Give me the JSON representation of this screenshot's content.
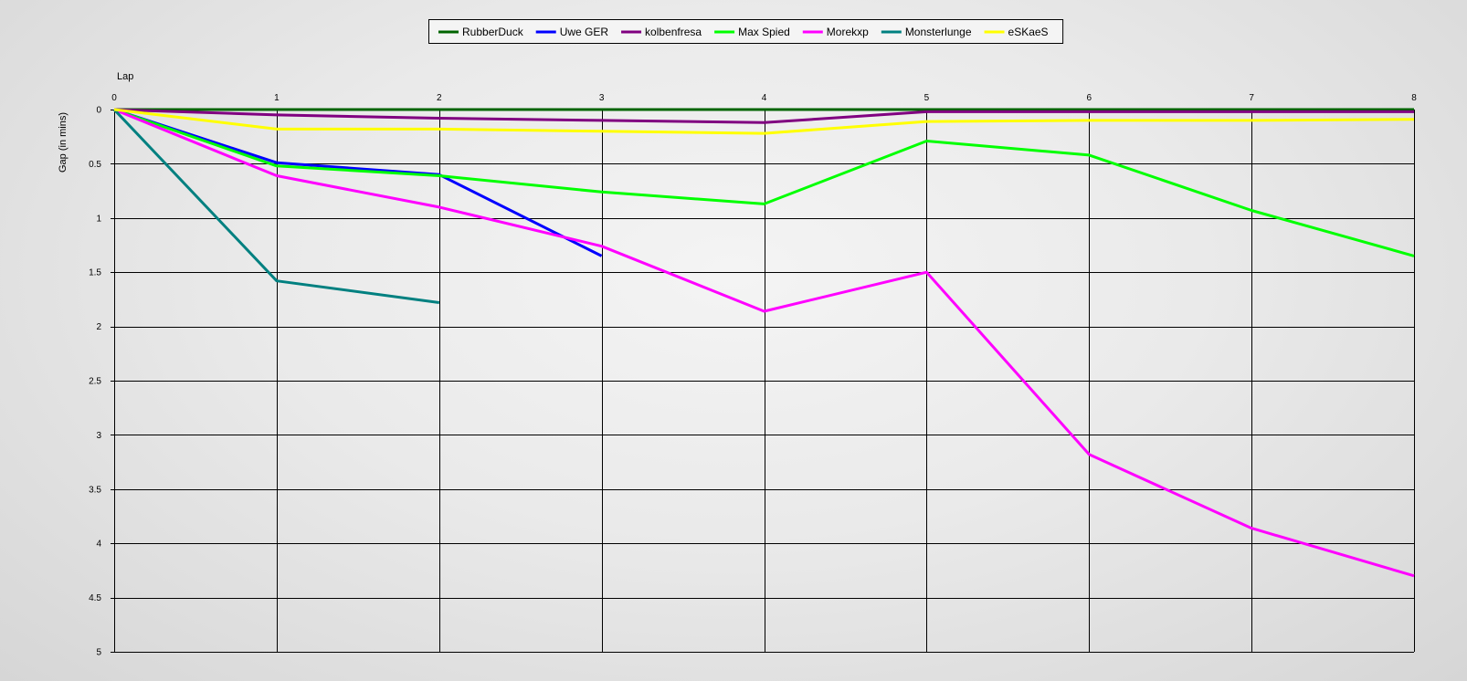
{
  "chart_data": {
    "type": "line",
    "xlabel": "Lap",
    "ylabel": "Gap (in mins)",
    "xlim": [
      0,
      8
    ],
    "ylim": [
      0,
      5
    ],
    "y_inverted": true,
    "x_ticks": [
      0,
      1,
      2,
      3,
      4,
      5,
      6,
      7,
      8
    ],
    "y_ticks": [
      0,
      0.5,
      1,
      1.5,
      2,
      2.5,
      3,
      3.5,
      4,
      4.5,
      5
    ],
    "grid": true,
    "legend_position": "top-center",
    "series": [
      {
        "name": "RubberDuck",
        "color": "#006400",
        "x": [
          0,
          1,
          2,
          3,
          4,
          5,
          6,
          7,
          8
        ],
        "y": [
          0,
          0,
          0,
          0,
          0,
          0,
          0,
          0,
          0
        ]
      },
      {
        "name": "Uwe GER",
        "color": "#0000ff",
        "x": [
          0,
          1,
          2,
          3
        ],
        "y": [
          0,
          0.49,
          0.6,
          1.35
        ]
      },
      {
        "name": "kolbenfresa",
        "color": "#800080",
        "x": [
          0,
          1,
          2,
          3,
          4,
          5,
          6,
          7,
          8
        ],
        "y": [
          0,
          0.05,
          0.08,
          0.1,
          0.12,
          0.02,
          0.02,
          0.02,
          0.02
        ]
      },
      {
        "name": "Max Spied",
        "color": "#00ff00",
        "x": [
          0,
          1,
          2,
          3,
          4,
          5,
          6,
          7,
          8
        ],
        "y": [
          0,
          0.52,
          0.61,
          0.76,
          0.87,
          0.29,
          0.42,
          0.93,
          1.35
        ]
      },
      {
        "name": "Morekxp",
        "color": "#ff00ff",
        "x": [
          0,
          1,
          2,
          3,
          4,
          5,
          6,
          7,
          8
        ],
        "y": [
          0,
          0.61,
          0.9,
          1.26,
          1.86,
          1.5,
          3.18,
          3.86,
          4.3
        ]
      },
      {
        "name": "Monsterlunge",
        "color": "#008080",
        "x": [
          0,
          1,
          2
        ],
        "y": [
          0,
          1.58,
          1.78
        ]
      },
      {
        "name": "eSKaeS",
        "color": "#ffff00",
        "x": [
          0,
          1,
          2,
          3,
          4,
          5,
          6,
          7,
          8
        ],
        "y": [
          0,
          0.18,
          0.18,
          0.2,
          0.22,
          0.11,
          0.1,
          0.1,
          0.09
        ]
      }
    ]
  }
}
